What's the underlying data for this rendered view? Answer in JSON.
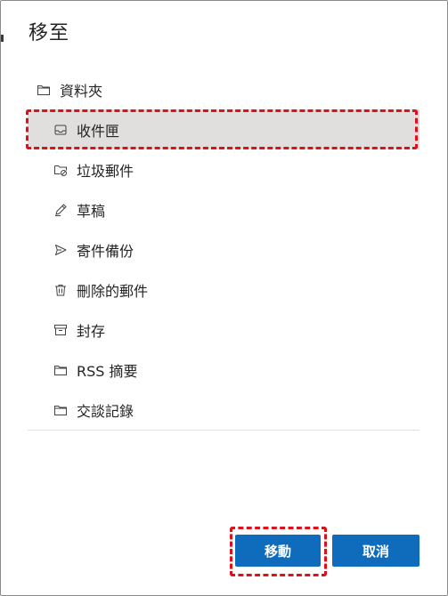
{
  "dialog": {
    "title": "移至"
  },
  "tree": {
    "root": {
      "label": "資料夾",
      "icon": "folder-icon"
    },
    "items": [
      {
        "label": "收件匣",
        "icon": "inbox-icon",
        "selected": true
      },
      {
        "label": "垃圾郵件",
        "icon": "junk-folder-icon",
        "selected": false
      },
      {
        "label": "草稿",
        "icon": "pencil-icon",
        "selected": false
      },
      {
        "label": "寄件備份",
        "icon": "send-icon",
        "selected": false
      },
      {
        "label": "刪除的郵件",
        "icon": "trash-icon",
        "selected": false
      },
      {
        "label": "封存",
        "icon": "archive-icon",
        "selected": false
      },
      {
        "label": "RSS 摘要",
        "icon": "folder-icon",
        "selected": false
      },
      {
        "label": "交談記錄",
        "icon": "folder-icon",
        "selected": false
      }
    ]
  },
  "buttons": {
    "move_label": "移動",
    "cancel_label": "取消"
  },
  "colors": {
    "primary": "#0f6cbd",
    "selected_bg": "#e1dfdd",
    "highlight": "#e0101a"
  }
}
